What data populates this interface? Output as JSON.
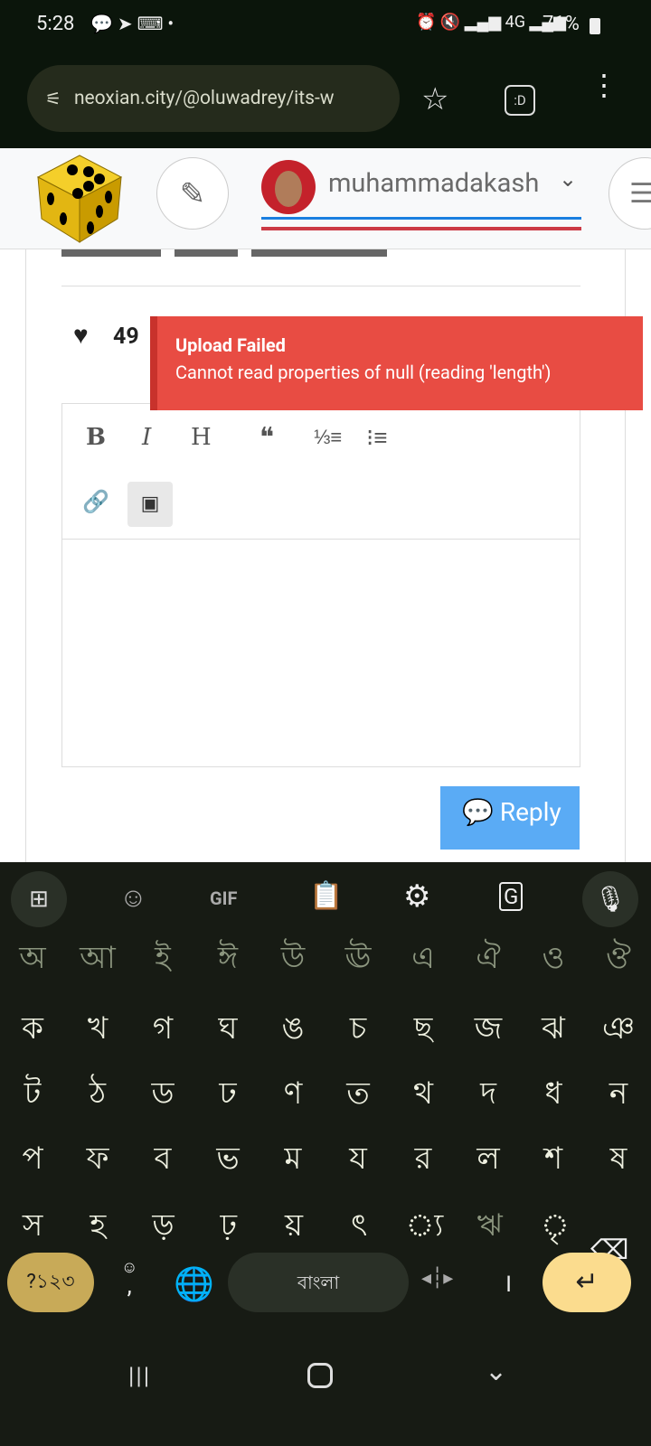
{
  "status": {
    "time": "5:28",
    "battery": "71%",
    "network": "4G"
  },
  "browser": {
    "url": "neoxian.city/@oluwadrey/its-w",
    "tab_icon": ":D"
  },
  "header": {
    "username": "muhammadakash"
  },
  "post": {
    "likes": "49"
  },
  "toast": {
    "title": "Upload Failed",
    "message": "Cannot read properties of null (reading 'length')"
  },
  "editor": {
    "bold": "B",
    "italic": "I",
    "heading": "H",
    "quote": "❝",
    "body": ""
  },
  "reply_button": "Reply",
  "keyboard": {
    "toolbar": {
      "gif": "GIF"
    },
    "rows": [
      [
        "অ",
        "আ",
        "ই",
        "ঈ",
        "উ",
        "ঊ",
        "এ",
        "ঐ",
        "ও",
        "ঔ"
      ],
      [
        "ক",
        "খ",
        "গ",
        "ঘ",
        "ঙ",
        "চ",
        "ছ",
        "জ",
        "ঝ",
        "ঞ"
      ],
      [
        "ট",
        "ঠ",
        "ড",
        "ঢ",
        "ণ",
        "ত",
        "থ",
        "দ",
        "ধ",
        "ন"
      ],
      [
        "প",
        "ফ",
        "ব",
        "ভ",
        "ম",
        "য",
        "র",
        "ল",
        "শ",
        "ষ"
      ],
      [
        "স",
        "হ",
        "ড়",
        "ঢ়",
        "য়",
        "ৎ",
        "্য",
        "ঋ",
        "ৃ"
      ]
    ],
    "symbols": "?১২৩",
    "comma": ",",
    "space": "বাংলা",
    "danda": "।"
  },
  "colors": {
    "toast": "#e84c43",
    "reply": "#5aabf5",
    "enter": "#fbdc8e",
    "symbols": "#c8aa58"
  }
}
